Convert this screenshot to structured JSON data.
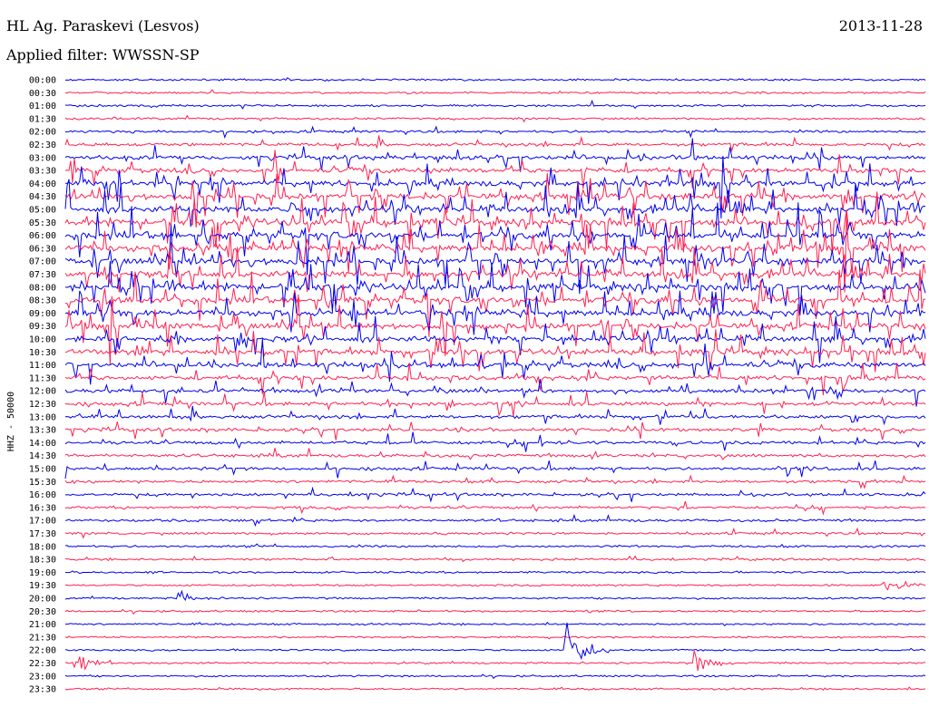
{
  "header": {
    "station": "HL Ag. Paraskevi (Lesvos)",
    "date": "2013-11-28",
    "filter": "Applied filter: WWSSN-SP"
  },
  "chart_data": {
    "type": "line",
    "title": "HL Ag. Paraskevi (Lesvos)",
    "date": "2013-11-28",
    "filter": "WWSSN-SP",
    "ylabel": "HHZ - 50000",
    "tick_labels": [
      "00:00",
      "00:30",
      "01:00",
      "01:30",
      "02:00",
      "02:30",
      "03:00",
      "03:30",
      "04:00",
      "04:30",
      "05:00",
      "05:30",
      "06:00",
      "06:30",
      "07:00",
      "07:30",
      "08:00",
      "08:30",
      "09:00",
      "09:30",
      "10:00",
      "10:30",
      "11:00",
      "11:30",
      "12:00",
      "12:30",
      "13:00",
      "13:30",
      "14:00",
      "14:30",
      "15:00",
      "15:30",
      "16:00",
      "16:30",
      "17:00",
      "17:30",
      "18:00",
      "18:30",
      "19:00",
      "19:30",
      "20:00",
      "20:30",
      "21:00",
      "21:30",
      "22:00",
      "22:30",
      "23:00",
      "23:30"
    ],
    "series_colors": [
      "#0000ee",
      "#ff2050"
    ],
    "activity_profile": [
      0.05,
      0.08,
      0.1,
      0.1,
      0.15,
      0.3,
      0.45,
      0.6,
      0.75,
      0.85,
      0.9,
      0.95,
      0.95,
      0.95,
      0.95,
      0.92,
      0.9,
      0.88,
      0.85,
      0.82,
      0.78,
      0.72,
      0.62,
      0.55,
      0.45,
      0.4,
      0.35,
      0.32,
      0.3,
      0.28,
      0.26,
      0.24,
      0.22,
      0.2,
      0.18,
      0.15,
      0.12,
      0.1,
      0.08,
      0.07,
      0.06,
      0.06,
      0.05,
      0.05,
      0.05,
      0.05,
      0.05,
      0.05
    ],
    "events": [
      {
        "row": 44,
        "position": 0.58,
        "amplitude": 6.0
      },
      {
        "row": 45,
        "position": 0.73,
        "amplitude": 2.0
      },
      {
        "row": 45,
        "position": 0.01,
        "amplitude": 2.5
      },
      {
        "row": 39,
        "position": 0.95,
        "amplitude": 1.5
      },
      {
        "row": 40,
        "position": 0.13,
        "amplitude": 1.2
      }
    ]
  }
}
